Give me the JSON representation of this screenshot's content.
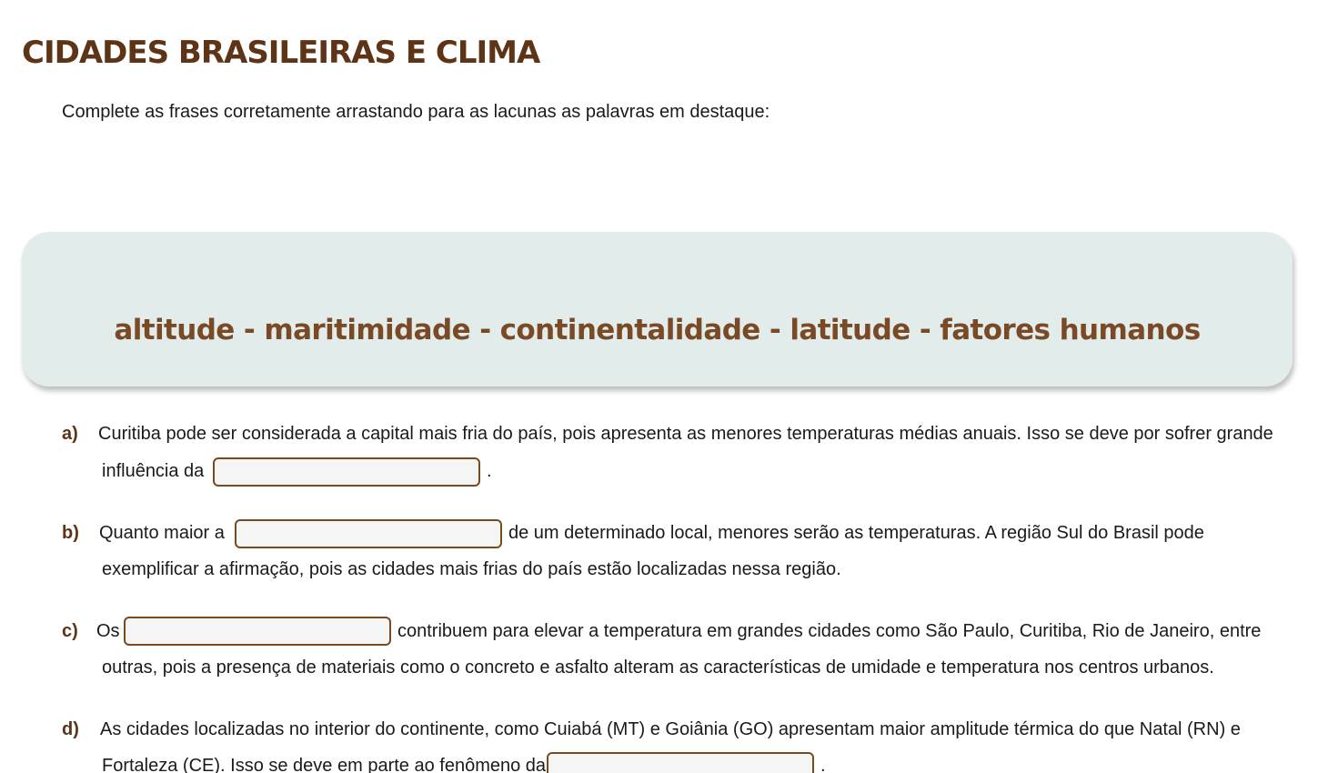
{
  "page": {
    "title": "CIDADES BRASILEIRAS E CLIMA",
    "instructions": "Complete as frases corretamente arrastando para as lacunas as palavras em destaque:"
  },
  "word_bank": {
    "text": "altitude - maritimidade - continentalidade - latitude - fatores humanos",
    "words": [
      "altitude",
      "maritimidade",
      "continentalidade",
      "latitude",
      "fatores humanos"
    ]
  },
  "questions": [
    {
      "letter": "a)",
      "line1": "Curitiba pode ser considerada a capital mais fria do país, pois apresenta as menores temperaturas médias anuais. Isso se deve por sofrer grande",
      "line2_before": "influência da",
      "line2_after": ".",
      "blank_value": ""
    },
    {
      "letter": "b)",
      "line1_before": "Quanto maior a",
      "line1_after": "de um determinado local, menores serão as temperaturas. A região Sul do Brasil pode",
      "line2": "exemplificar a afirmação, pois as cidades mais frias do país estão localizadas nessa região.",
      "blank_value": ""
    },
    {
      "letter": "c)",
      "line1_before": "Os",
      "line1_after": "contribuem para elevar a temperatura em grandes cidades como São Paulo, Curitiba, Rio de Janeiro, entre",
      "line2": "outras, pois a presença de materiais como o concreto e asfalto alteram as características de umidade e temperatura nos centros urbanos.",
      "blank_value": ""
    },
    {
      "letter": "d)",
      "line1": "As cidades localizadas no interior do continente, como Cuiabá (MT) e Goiânia (GO) apresentam maior amplitude térmica do que Natal (RN) e",
      "line2_before": "Fortaleza (CE). Isso se deve em parte ao fenômeno da",
      "line2_after": ".",
      "blank_value": ""
    }
  ],
  "colors": {
    "title": "#5e3417",
    "word_bank_bg": "#e2ecea",
    "word_bank_text": "#7a4a26",
    "blank_border": "#7a4a1f"
  }
}
